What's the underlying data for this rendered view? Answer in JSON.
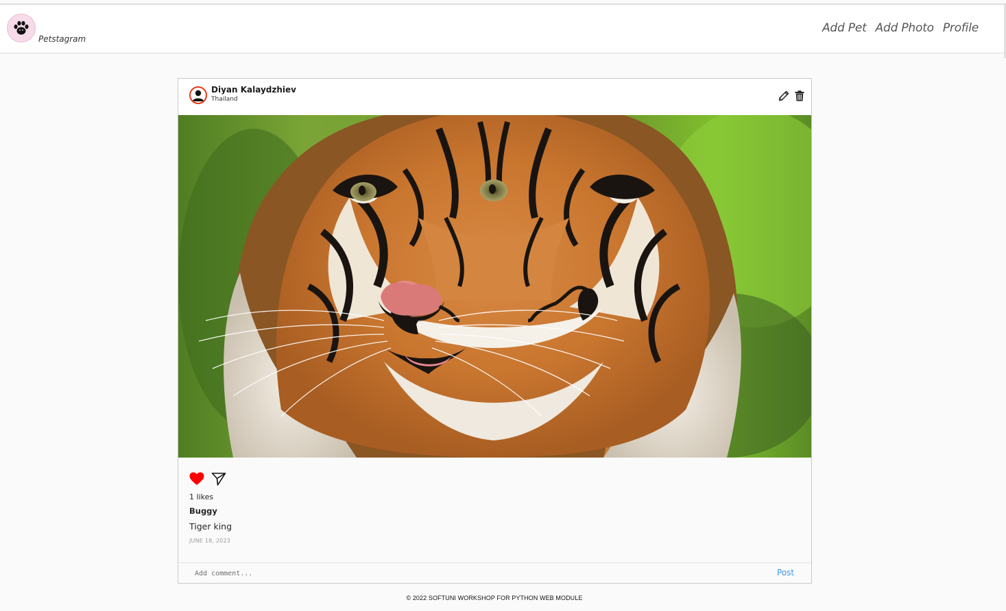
{
  "app": {
    "brand": "Petstagram",
    "logo_icon": "paw-icon"
  },
  "nav": {
    "items": [
      {
        "label": "Add Pet"
      },
      {
        "label": "Add Photo"
      },
      {
        "label": "Profile"
      }
    ]
  },
  "post": {
    "owner_name": "Diyan Kalaydzhiev",
    "location": "Thailand",
    "edit_icon": "pencil-icon",
    "delete_icon": "trash-icon",
    "photo_subject": "tiger face photo",
    "like_icon": "heart-icon",
    "share_icon": "send-icon",
    "likes": "1 likes",
    "pet_name": "Buggy",
    "caption": "Tiger king",
    "date": "JUNE 18, 2023",
    "comment_placeholder": "Add comment...",
    "post_label": "Post",
    "colors": {
      "like": "#ff0000",
      "avatar_ring": "#e23b14",
      "post_button": "#3897f0",
      "logo_bg": "#f8dbe9"
    }
  },
  "footer": {
    "text": "© 2022 SOFTUNI WORKSHOP FOR PYTHON WEB MODULE"
  }
}
